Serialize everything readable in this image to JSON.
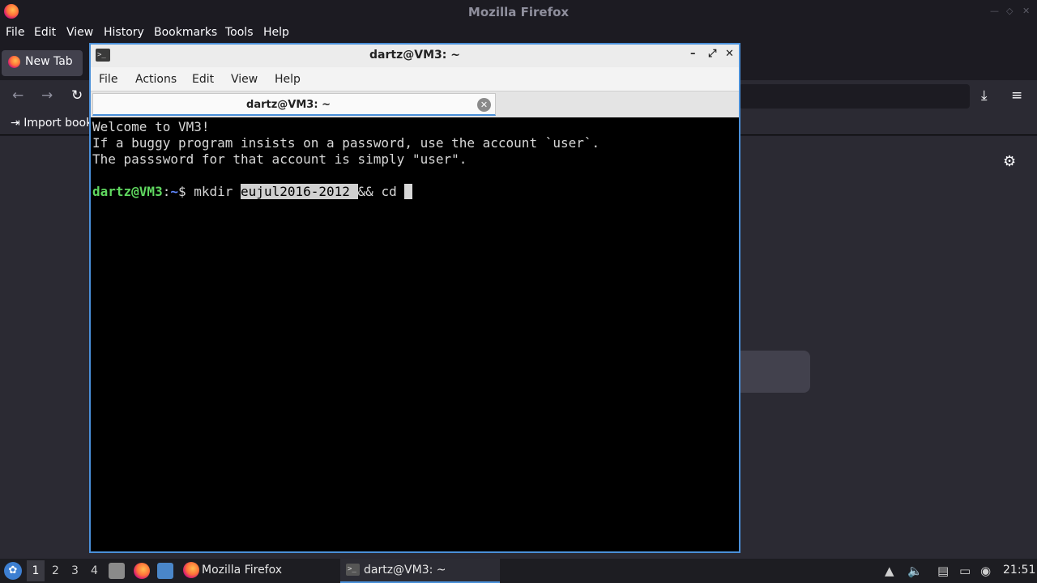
{
  "firefox": {
    "window_title": "Mozilla Firefox",
    "menu": [
      "File",
      "Edit",
      "View",
      "History",
      "Bookmarks",
      "Tools",
      "Help"
    ],
    "tab_label": "New Tab",
    "bookmark_import_label": "Import book"
  },
  "terminal": {
    "window_title": "dartz@VM3: ~",
    "menu": [
      "File",
      "Actions",
      "Edit",
      "View",
      "Help"
    ],
    "tab_label": "dartz@VM3: ~",
    "lines": [
      "Welcome to VM3!",
      "If a buggy program insists on a password, use the account `user`.",
      "The passsword for that account is simply \"user\"."
    ],
    "prompt": {
      "user_host": "dartz@VM3",
      "separator": ":",
      "path": "~",
      "symbol": "$ ",
      "command_before": "mkdir ",
      "selected_text": "eujul2016-2012 ",
      "command_after": "&& cd "
    }
  },
  "taskbar": {
    "workspaces": [
      "1",
      "2",
      "3",
      "4"
    ],
    "tasks": [
      "Mozilla Firefox",
      "dartz@VM3: ~"
    ],
    "clock": "21:51"
  }
}
